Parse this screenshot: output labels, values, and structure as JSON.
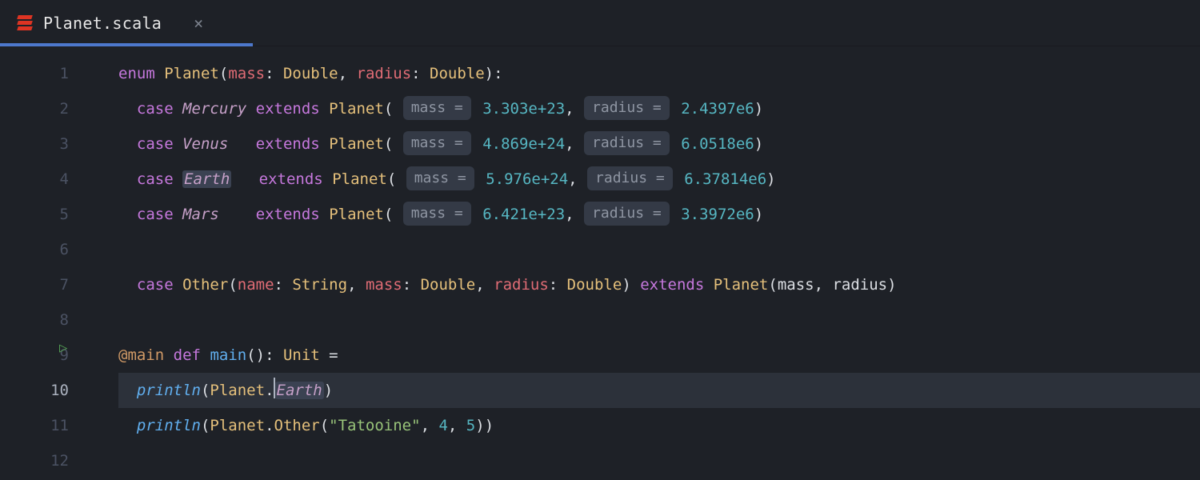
{
  "tab": {
    "filename": "Planet.scala"
  },
  "gutter": {
    "lines": [
      "1",
      "2",
      "3",
      "4",
      "5",
      "6",
      "7",
      "8",
      "9",
      "10",
      "11",
      "12"
    ]
  },
  "tokens": {
    "enum": "enum",
    "case": "case",
    "extends": "extends",
    "def": "def",
    "main": "main",
    "at_main": "@main",
    "Planet": "Planet",
    "mass_param": "mass",
    "radius_param": "radius",
    "name_param": "name",
    "Double": "Double",
    "String": "String",
    "Unit": "Unit",
    "println": "println",
    "Other": "Other",
    "Earth_sel": "Earth",
    "Tatooine_str": "\"Tatooine\""
  },
  "hints": {
    "mass": "mass =",
    "radius": "radius ="
  },
  "planets": [
    {
      "name": "Mercury",
      "pad": "",
      "mass": "3.303e+23",
      "radius": "2.4397e6"
    },
    {
      "name": "Venus",
      "pad": "  ",
      "mass": "4.869e+24",
      "radius": "6.0518e6"
    },
    {
      "name": "Earth",
      "pad": "  ",
      "mass": "5.976e+24",
      "radius": "6.37814e6"
    },
    {
      "name": "Mars",
      "pad": "   ",
      "mass": "6.421e+23",
      "radius": "3.3972e6"
    }
  ],
  "mainCall": {
    "args": {
      "n1": "4",
      "n2": "5"
    }
  }
}
